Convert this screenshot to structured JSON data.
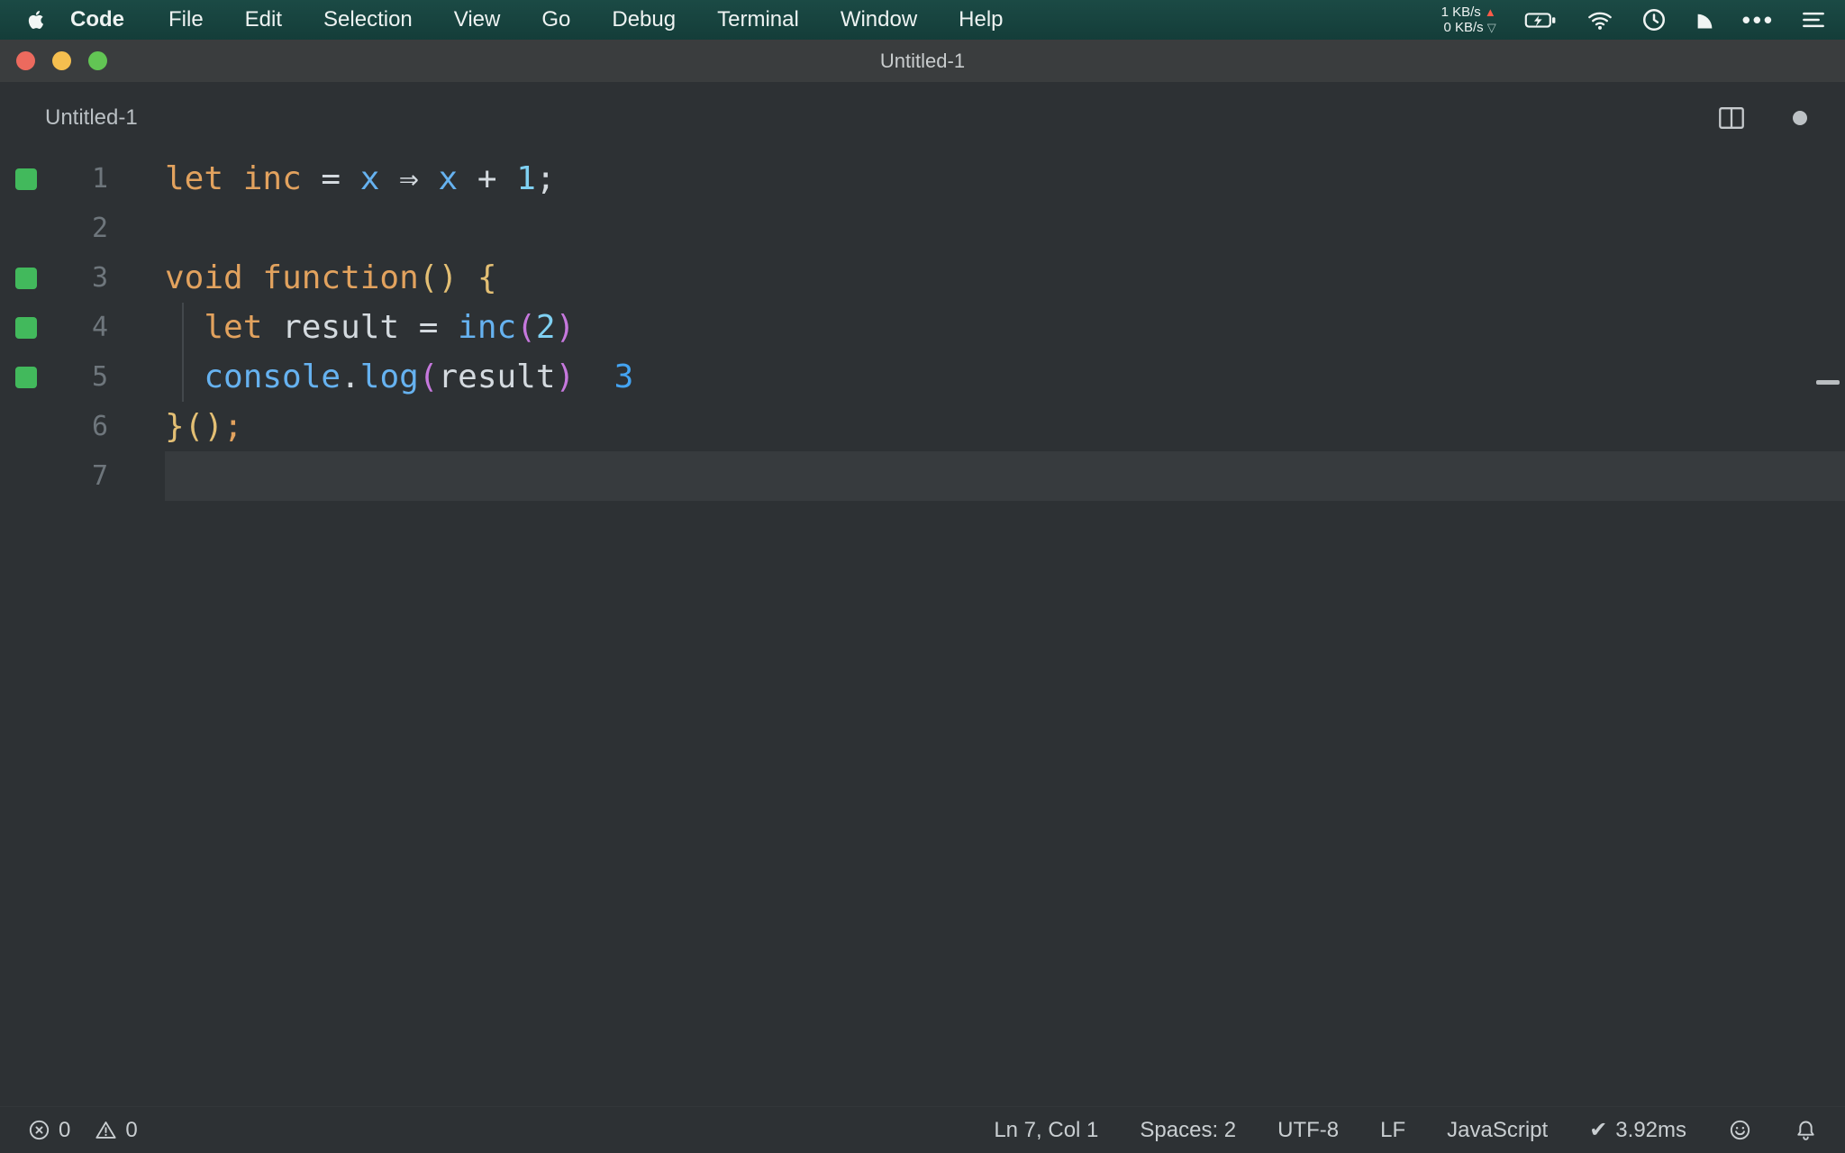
{
  "menubar": {
    "app_name": "Code",
    "items": [
      "File",
      "Edit",
      "Selection",
      "View",
      "Go",
      "Debug",
      "Terminal",
      "Window",
      "Help"
    ],
    "net_up": "1 KB/s",
    "net_down": "0 KB/s"
  },
  "titlebar": {
    "title": "Untitled-1"
  },
  "editor": {
    "tab_label": "Untitled-1",
    "lines": [
      {
        "num": "1",
        "covered": true,
        "current": false,
        "tokens": [
          {
            "c": "orange",
            "t": "let"
          },
          {
            "c": "plain",
            "t": " "
          },
          {
            "c": "orange",
            "t": "inc"
          },
          {
            "c": "plain",
            "t": " = "
          },
          {
            "c": "blue",
            "t": "x"
          },
          {
            "c": "plain",
            "t": " ⇒ "
          },
          {
            "c": "blue",
            "t": "x"
          },
          {
            "c": "plain",
            "t": " + "
          },
          {
            "c": "num",
            "t": "1"
          },
          {
            "c": "plain",
            "t": ";"
          }
        ]
      },
      {
        "num": "2",
        "covered": false,
        "current": false,
        "tokens": []
      },
      {
        "num": "3",
        "covered": true,
        "current": false,
        "tokens": [
          {
            "c": "orange",
            "t": "void"
          },
          {
            "c": "plain",
            "t": " "
          },
          {
            "c": "orange",
            "t": "function"
          },
          {
            "c": "yellow",
            "t": "()"
          },
          {
            "c": "plain",
            "t": " "
          },
          {
            "c": "yellow",
            "t": "{"
          }
        ]
      },
      {
        "num": "4",
        "covered": true,
        "current": false,
        "tokens": [
          {
            "c": "plain",
            "t": "  "
          },
          {
            "c": "orange",
            "t": "let"
          },
          {
            "c": "plain",
            "t": " "
          },
          {
            "c": "plain",
            "t": "result"
          },
          {
            "c": "plain",
            "t": " = "
          },
          {
            "c": "blue",
            "t": "inc"
          },
          {
            "c": "magenta",
            "t": "("
          },
          {
            "c": "num",
            "t": "2"
          },
          {
            "c": "magenta",
            "t": ")"
          }
        ]
      },
      {
        "num": "5",
        "covered": true,
        "current": false,
        "tokens": [
          {
            "c": "plain",
            "t": "  "
          },
          {
            "c": "blue",
            "t": "console"
          },
          {
            "c": "plain",
            "t": "."
          },
          {
            "c": "blue",
            "t": "log"
          },
          {
            "c": "magenta",
            "t": "("
          },
          {
            "c": "plain",
            "t": "result"
          },
          {
            "c": "magenta",
            "t": ")"
          },
          {
            "c": "plain",
            "t": "  "
          },
          {
            "c": "val",
            "t": "3"
          }
        ]
      },
      {
        "num": "6",
        "covered": false,
        "current": false,
        "tokens": [
          {
            "c": "yellow",
            "t": "}()"
          },
          {
            "c": "orange",
            "t": ";"
          }
        ]
      },
      {
        "num": "7",
        "covered": false,
        "current": true,
        "tokens": []
      }
    ]
  },
  "statusbar": {
    "errors": "0",
    "warnings": "0",
    "cursor": "Ln 7, Col 1",
    "indent": "Spaces: 2",
    "encoding": "UTF-8",
    "eol": "LF",
    "language": "JavaScript",
    "timing": "3.92ms"
  },
  "icons": {
    "ellipsis": "•••",
    "check": "✔",
    "up_arrow": "▲",
    "down_arrow": "▽"
  },
  "colors": {
    "menubar_teal": "#17433f",
    "coverage_green": "#42b95c",
    "keyword_orange": "#e2a25e",
    "identifier_blue": "#66b2f0",
    "paren_magenta": "#c678dd",
    "brace_yellow": "#e3bf74",
    "inline_value_blue": "#44a4f2",
    "editor_background": "#2d3134",
    "titlebar_gray": "#3a3d3e"
  }
}
